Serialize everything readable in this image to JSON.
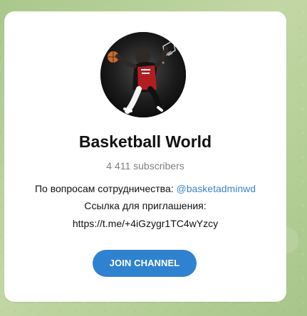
{
  "channel": {
    "title": "Basketball World",
    "subscribers": "4 411 subscribers",
    "avatar": "basketball-player-avatar"
  },
  "description": {
    "line1_prefix": "По вопросам сотрудничества: ",
    "mention": "@basketadminwd",
    "line2": "Ссылка для приглашения:",
    "line3": "https://t.me/+4iGzygr1TC4wYzcy"
  },
  "actions": {
    "join_label": "JOIN CHANNEL"
  },
  "colors": {
    "accent": "#2f82cf",
    "link": "#3f84c7",
    "wallpaper": "#b7cf9b"
  }
}
